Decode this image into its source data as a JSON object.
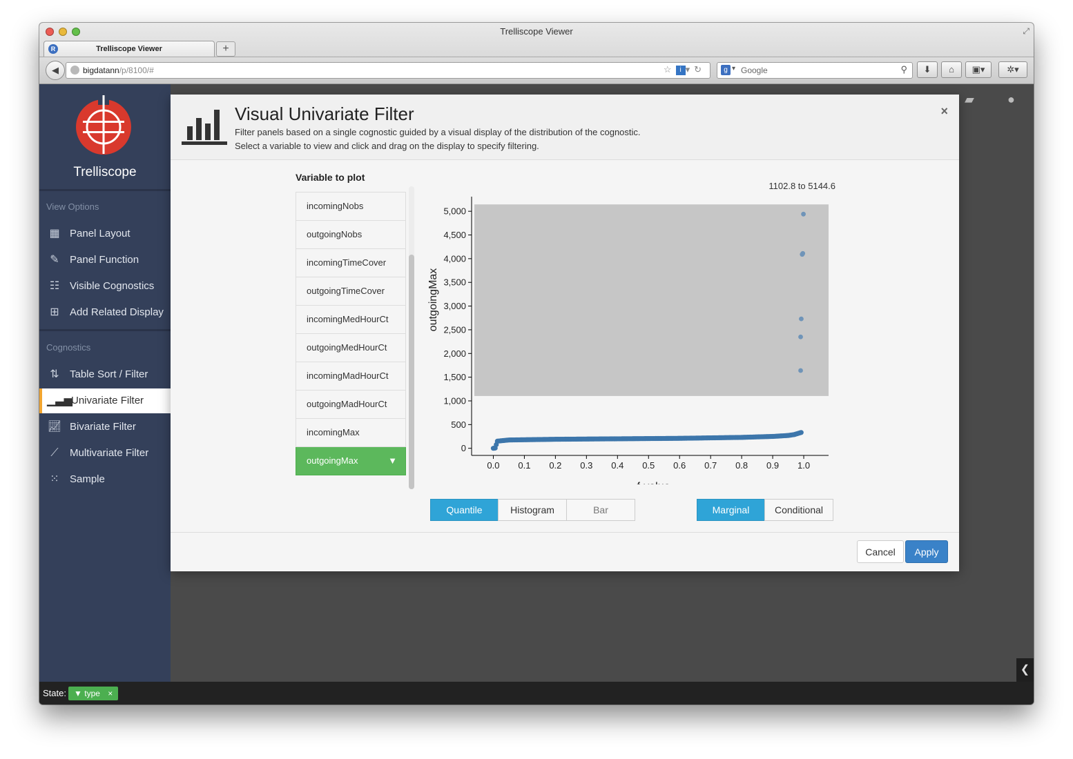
{
  "browser": {
    "window_title": "Trelliscope Viewer",
    "tab_title": "Trelliscope Viewer",
    "url_host": "bigdatann",
    "url_path": "/p/8100/#",
    "search_placeholder": "Google"
  },
  "sidebar": {
    "logo_text": "Trelliscope",
    "view_options_title": "View Options",
    "view_options": [
      {
        "label": "Panel Layout",
        "icon": "grid-icon"
      },
      {
        "label": "Panel Function",
        "icon": "edit-icon"
      },
      {
        "label": "Visible Cognostics",
        "icon": "table-settings-icon"
      },
      {
        "label": "Add Related Display",
        "icon": "plus-square-icon"
      }
    ],
    "cognostics_title": "Cognostics",
    "cognostics": [
      {
        "label": "Table Sort / Filter",
        "icon": "table-sort-icon"
      },
      {
        "label": "Univariate Filter",
        "icon": "bar-chart-icon",
        "active": true
      },
      {
        "label": "Bivariate Filter",
        "icon": "line-chart-icon"
      },
      {
        "label": "Multivariate Filter",
        "icon": "scatter-chart-icon"
      },
      {
        "label": "Sample",
        "icon": "dots-icon"
      }
    ]
  },
  "status": {
    "label": "State:",
    "chip_label": "type",
    "chip_close": "×"
  },
  "modal": {
    "title": "Visual Univariate Filter",
    "subtitle1": "Filter panels based on a single cognostic guided by a visual display of the distribution of the cognostic.",
    "subtitle2": "Select a variable to view and click and drag on the display to specify filtering.",
    "close": "×",
    "variable_heading": "Variable to plot",
    "variables": [
      "incomingNobs",
      "outgoingNobs",
      "incomingTimeCover",
      "outgoingTimeCover",
      "incomingMedHourCt",
      "outgoingMedHourCt",
      "incomingMadHourCt",
      "outgoingMadHourCt",
      "incomingMax",
      "outgoingMax"
    ],
    "selected_variable": "outgoingMax",
    "plot_types": [
      "Quantile",
      "Histogram",
      "Bar"
    ],
    "active_plot_type": "Quantile",
    "conditioning": [
      "Marginal",
      "Conditional"
    ],
    "active_conditioning": "Marginal",
    "cancel_label": "Cancel",
    "apply_label": "Apply"
  },
  "colors": {
    "sidebar_bg": "#34405a",
    "accent_active": "#f2a530",
    "selected_green": "#5cb85c",
    "button_blue": "#2fa4d7",
    "apply_blue": "#3a82c8",
    "point_color": "#3d76ab",
    "brush_gray": "#c6c6c6",
    "logo_red": "#d9392d"
  },
  "chart_data": {
    "type": "scatter",
    "xlabel": "f-value",
    "ylabel": "outgoingMax",
    "xlim": [
      -0.07,
      1.08
    ],
    "ylim": [
      -150,
      5250
    ],
    "x_ticks": [
      "0.0",
      "0.1",
      "0.2",
      "0.3",
      "0.4",
      "0.5",
      "0.6",
      "0.7",
      "0.8",
      "0.9",
      "1.0"
    ],
    "y_ticks": [
      "0",
      "500",
      "1,000",
      "1,500",
      "2,000",
      "2,500",
      "3,000",
      "3,500",
      "4,000",
      "4,500",
      "5,000"
    ],
    "grid": false,
    "selection_label": "1102.8 to 5144.6",
    "selection_range": [
      1102.8,
      5144.6
    ],
    "outliers": [
      {
        "x": 0.999,
        "y": 4940
      },
      {
        "x": 0.997,
        "y": 4110
      },
      {
        "x": 0.995,
        "y": 4090
      },
      {
        "x": 0.992,
        "y": 2730
      },
      {
        "x": 0.99,
        "y": 2350
      },
      {
        "x": 0.99,
        "y": 1640
      }
    ],
    "curve": [
      {
        "x": 0.0,
        "y": 0
      },
      {
        "x": 0.006,
        "y": 5
      },
      {
        "x": 0.013,
        "y": 150
      },
      {
        "x": 0.05,
        "y": 175
      },
      {
        "x": 0.2,
        "y": 190
      },
      {
        "x": 0.4,
        "y": 200
      },
      {
        "x": 0.6,
        "y": 210
      },
      {
        "x": 0.8,
        "y": 230
      },
      {
        "x": 0.9,
        "y": 250
      },
      {
        "x": 0.95,
        "y": 270
      },
      {
        "x": 0.97,
        "y": 290
      },
      {
        "x": 0.985,
        "y": 320
      },
      {
        "x": 0.995,
        "y": 340
      }
    ]
  }
}
